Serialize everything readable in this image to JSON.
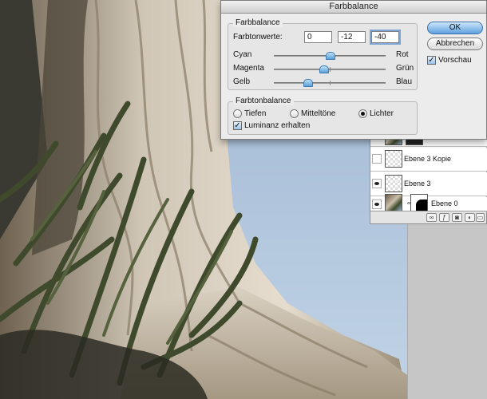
{
  "dialog": {
    "title": "Farbbalance",
    "balance_group": "Farbbalance",
    "tone_values_label": "Farbtonwerte:",
    "values": [
      "0",
      "-12",
      "-40"
    ],
    "sliders": [
      {
        "left": "Cyan",
        "right": "Rot",
        "value": 0
      },
      {
        "left": "Magenta",
        "right": "Grün",
        "value": -12
      },
      {
        "left": "Gelb",
        "right": "Blau",
        "value": -40
      }
    ],
    "slider_range": [
      -100,
      100
    ],
    "tone_group": "Farbtonbalance",
    "tones": {
      "shadows": "Tiefen",
      "midtones": "Mitteltöne",
      "highlights": "Lichter",
      "selected": "highlights"
    },
    "preserve_luminosity": {
      "label": "Luminanz erhalten",
      "checked": true
    },
    "ok_label": "OK",
    "cancel_label": "Abbrechen",
    "preview": {
      "label": "Vorschau",
      "checked": true
    }
  },
  "layers": {
    "rows": [
      {
        "name": "Ebene 3 Kopie",
        "visible": false
      },
      {
        "name": "Ebene 3",
        "visible": true
      },
      {
        "name": "Ebene 0",
        "visible": true
      }
    ]
  }
}
